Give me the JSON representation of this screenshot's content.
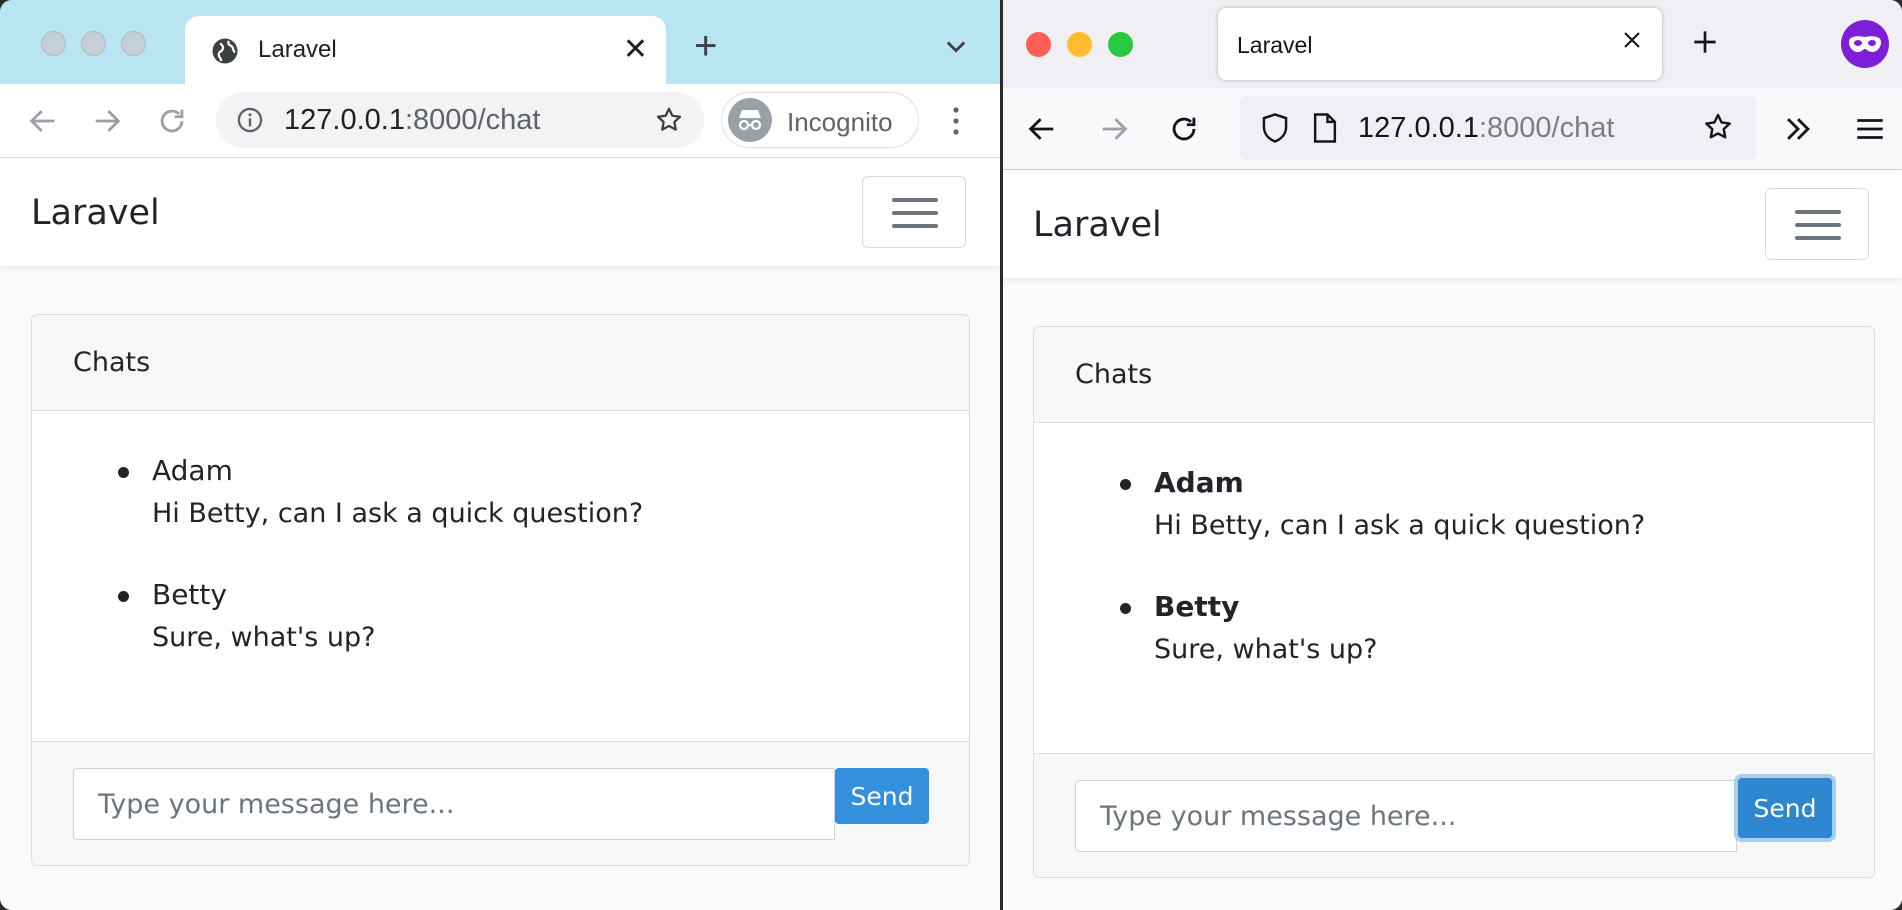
{
  "left_browser": {
    "tab_title": "Laravel",
    "url_host": "127.0.0.1",
    "url_rest": ":8000/chat",
    "incognito_label": "Incognito"
  },
  "right_browser": {
    "tab_title": "Laravel",
    "url_host": "127.0.0.1",
    "url_rest": ":8000/chat"
  },
  "page": {
    "brand": "Laravel",
    "card_title": "Chats",
    "messages": [
      {
        "user": "Adam",
        "text": "Hi Betty, can I ask a quick question?"
      },
      {
        "user": "Betty",
        "text": "Sure, what's up?"
      }
    ],
    "input_placeholder": "Type your message here...",
    "send_label": "Send"
  },
  "colors": {
    "chrome_tabstrip": "#b8e5f1",
    "send_button": "#3490dc",
    "firefox_account": "#7c1fd6",
    "mac_close": "#ff5f57",
    "mac_minimize": "#febc2e",
    "mac_zoom": "#28c840"
  },
  "icons": [
    "globe-icon",
    "close-icon",
    "plus-icon",
    "chevron-down-icon",
    "back-arrow-icon",
    "forward-arrow-icon",
    "reload-icon",
    "info-icon",
    "star-icon",
    "incognito-icon",
    "kebab-menu-icon",
    "shield-icon",
    "page-icon",
    "overflow-chevrons-icon",
    "hamburger-icon",
    "account-mask-icon"
  ]
}
